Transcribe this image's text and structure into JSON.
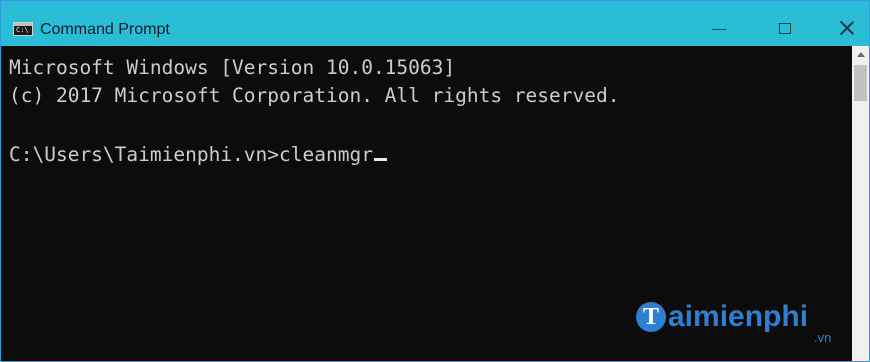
{
  "window": {
    "title": "Command Prompt",
    "icon_label": "C:\\",
    "accent_color": "#2bbcd6"
  },
  "controls": {
    "minimize_icon": "minimize-icon",
    "maximize_icon": "maximize-icon",
    "close_icon": "close-icon"
  },
  "console": {
    "lines": [
      "Microsoft Windows [Version 10.0.15063]",
      "(c) 2017 Microsoft Corporation. All rights reserved.",
      "",
      "C:\\Users\\Taimienphi.vn>cleanmgr"
    ],
    "background_color": "#0c0c0c",
    "text_color": "#cccccc"
  },
  "watermark": {
    "logo_letter": "T",
    "text": "aimienphi",
    "suffix": ".vn"
  }
}
